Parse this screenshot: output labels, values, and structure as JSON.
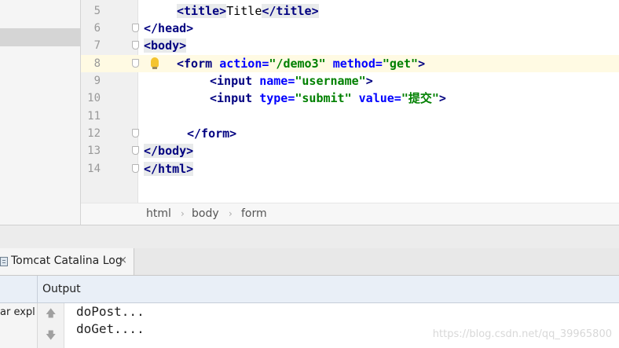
{
  "editor": {
    "lines": [
      {
        "num": "5",
        "c": "{\"t\":\"title\"}"
      },
      {
        "num": "6"
      },
      {
        "num": "7"
      },
      {
        "num": "8"
      },
      {
        "num": "9"
      },
      {
        "num": "10"
      },
      {
        "num": "11"
      },
      {
        "num": "12"
      },
      {
        "num": "13"
      },
      {
        "num": "14"
      }
    ],
    "code": {
      "l5_open": "<title>",
      "l5_text": "Title",
      "l5_close": "</title>",
      "l6": "</head>",
      "l7": "<body>",
      "l8_open": "<form",
      "l8_a1": "action=",
      "l8_v1": "\"/demo3\"",
      "l8_a2": "method=",
      "l8_v2": "\"get\"",
      "l8_close": ">",
      "l9_open": "<input",
      "l9_a1": "name=",
      "l9_v1": "\"username\"",
      "l9_close": ">",
      "l10_open": "<input",
      "l10_a1": "type=",
      "l10_v1": "\"submit\"",
      "l10_a2": "value=",
      "l10_v2": "\"提交\"",
      "l10_close": ">",
      "l12": "</form>",
      "l13": "</body>",
      "l14": "</html>"
    }
  },
  "breadcrumb": {
    "items": [
      "html",
      "body",
      "form"
    ],
    "separator": "›"
  },
  "tool_tab": {
    "label": "Tomcat Catalina Log",
    "close": "×"
  },
  "output": {
    "header": "Output",
    "left_label": "ar expl",
    "up_arrow": "🡅",
    "down_arrow": "🡇",
    "lines": [
      "doPost...",
      "doGet...."
    ],
    "watermark": "https://blog.csdn.net/qq_39965800"
  }
}
